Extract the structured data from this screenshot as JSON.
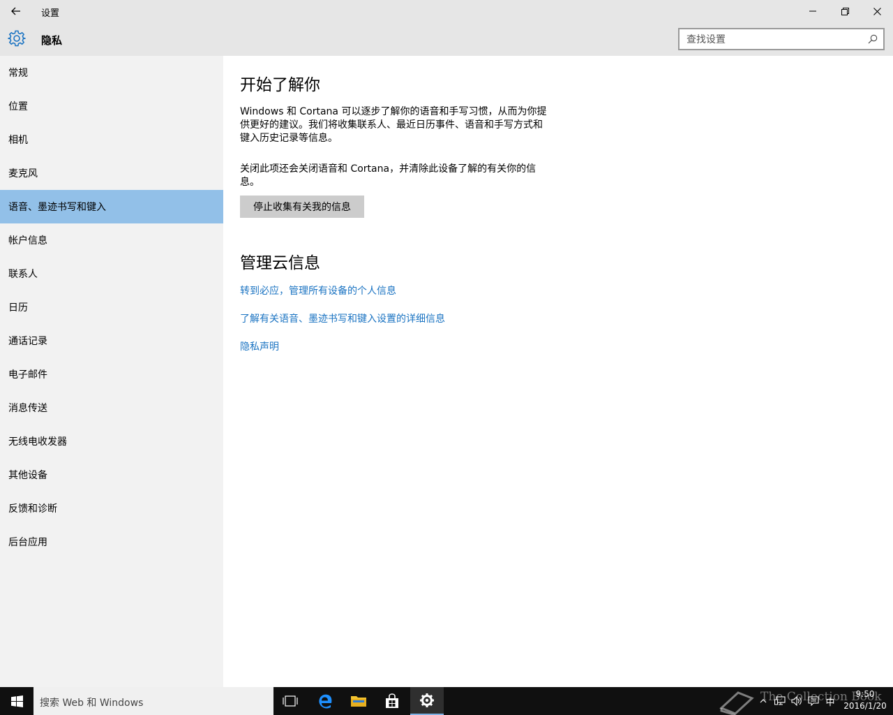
{
  "window": {
    "title": "设置",
    "back_icon": "back-arrow-icon",
    "minimize_icon": "minimize-icon",
    "maximize_icon": "restore-icon",
    "close_icon": "close-icon"
  },
  "header": {
    "icon": "gear-icon",
    "title": "隐私",
    "search_placeholder": "查找设置"
  },
  "sidebar": {
    "items": [
      {
        "label": "常规",
        "selected": false
      },
      {
        "label": "位置",
        "selected": false
      },
      {
        "label": "相机",
        "selected": false
      },
      {
        "label": "麦克风",
        "selected": false
      },
      {
        "label": "语音、墨迹书写和键入",
        "selected": true
      },
      {
        "label": "帐户信息",
        "selected": false
      },
      {
        "label": "联系人",
        "selected": false
      },
      {
        "label": "日历",
        "selected": false
      },
      {
        "label": "通话记录",
        "selected": false
      },
      {
        "label": "电子邮件",
        "selected": false
      },
      {
        "label": "消息传送",
        "selected": false
      },
      {
        "label": "无线电收发器",
        "selected": false
      },
      {
        "label": "其他设备",
        "selected": false
      },
      {
        "label": "反馈和诊断",
        "selected": false
      },
      {
        "label": "后台应用",
        "selected": false
      }
    ]
  },
  "main": {
    "section1_title": "开始了解你",
    "para1": "Windows 和 Cortana 可以逐步了解你的语音和手写习惯，从而为你提供更好的建议。我们将收集联系人、最近日历事件、语音和手写方式和键入历史记录等信息。",
    "para2": "关闭此项还会关闭语音和 Cortana，并清除此设备了解的有关你的信息。",
    "stop_button": "停止收集有关我的信息",
    "section2_title": "管理云信息",
    "link1": "转到必应，管理所有设备的个人信息",
    "link2": "了解有关语音、墨迹书写和键入设置的详细信息",
    "link3": "隐私声明"
  },
  "taskbar": {
    "search_text": "搜索 Web 和 Windows",
    "icons": [
      "windows-start-icon",
      "task-view-icon",
      "edge-icon",
      "file-explorer-icon",
      "store-icon",
      "settings-icon"
    ],
    "ime": "中",
    "time": "9:50",
    "date": "2016/1/20",
    "watermark": "The Collection Book"
  },
  "colors": {
    "accent": "#1a73c2",
    "selected_nav": "#92c0e8",
    "chrome": "#e6e6e6",
    "sidebar": "#f2f2f2",
    "taskbar": "#101010"
  }
}
